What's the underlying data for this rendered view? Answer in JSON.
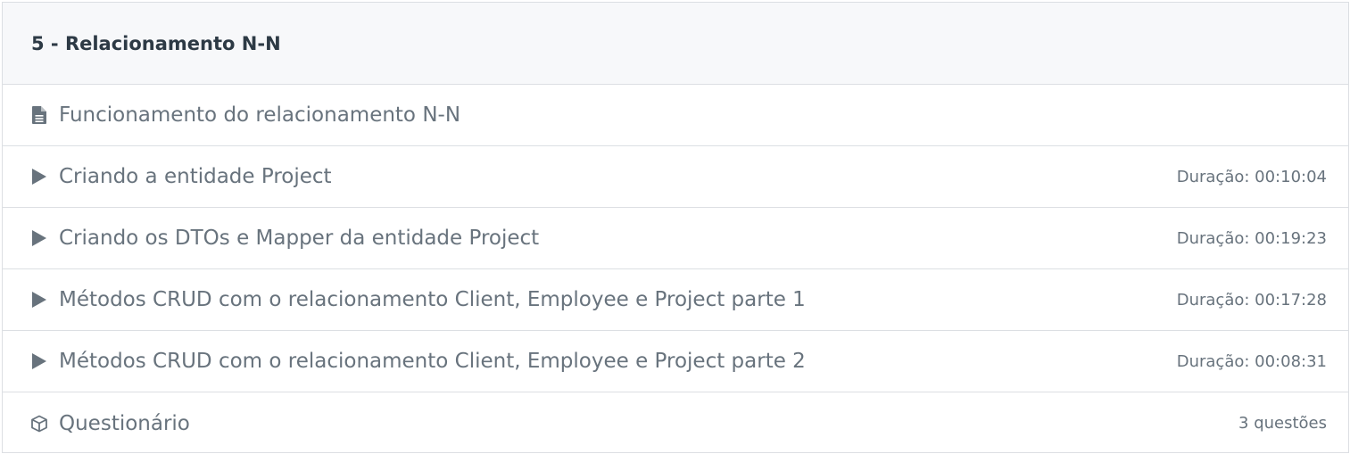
{
  "section": {
    "title": "5 - Relacionamento N-N"
  },
  "items": [
    {
      "type": "document",
      "icon": "document-icon",
      "label": "Funcionamento do relacionamento N-N",
      "meta": ""
    },
    {
      "type": "video",
      "icon": "play-icon",
      "label": "Criando a entidade Project",
      "meta": "Duração: 00:10:04"
    },
    {
      "type": "video",
      "icon": "play-icon",
      "label": "Criando os DTOs e Mapper da entidade Project",
      "meta": "Duração: 00:19:23"
    },
    {
      "type": "video",
      "icon": "play-icon",
      "label": "Métodos CRUD com o relacionamento Client, Employee e Project parte 1",
      "meta": "Duração: 00:17:28"
    },
    {
      "type": "video",
      "icon": "play-icon",
      "label": "Métodos CRUD com o relacionamento Client, Employee e Project parte 2",
      "meta": "Duração: 00:08:31"
    },
    {
      "type": "quiz",
      "icon": "cube-icon",
      "label": "Questionário",
      "meta": "3 questões"
    }
  ],
  "colors": {
    "border": "#dcdfe3",
    "header_bg": "#f7f8fa",
    "title": "#2d3a45",
    "text": "#68737d"
  }
}
